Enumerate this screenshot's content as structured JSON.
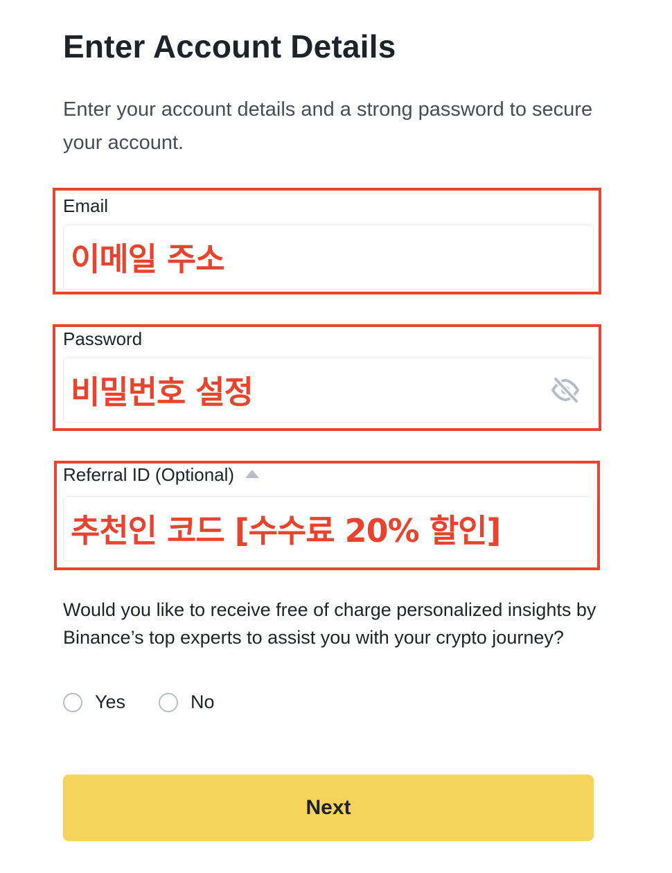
{
  "header": {
    "title": "Enter Account Details",
    "subtitle": "Enter your account details and a strong password to secure your account."
  },
  "form": {
    "email": {
      "label": "Email",
      "value": "이메일 주소"
    },
    "password": {
      "label": "Password",
      "value": "비밀번호 설정",
      "toggle_icon": "eye-slash-icon"
    },
    "referral": {
      "label": "Referral ID (Optional)",
      "toggle_icon": "caret-up-icon",
      "value": "추천인 코드 [수수료 20% 할인]"
    },
    "insights_question": "Would you like to receive free of charge personalized insights by Binance’s top experts to assist you with your crypto journey?",
    "options": {
      "yes": "Yes",
      "no": "No"
    },
    "submit_label": "Next"
  },
  "colors": {
    "annotation_red": "#e8432d",
    "button_yellow": "#f6d35a",
    "text_primary": "#1e2329",
    "text_secondary": "#474d57"
  }
}
